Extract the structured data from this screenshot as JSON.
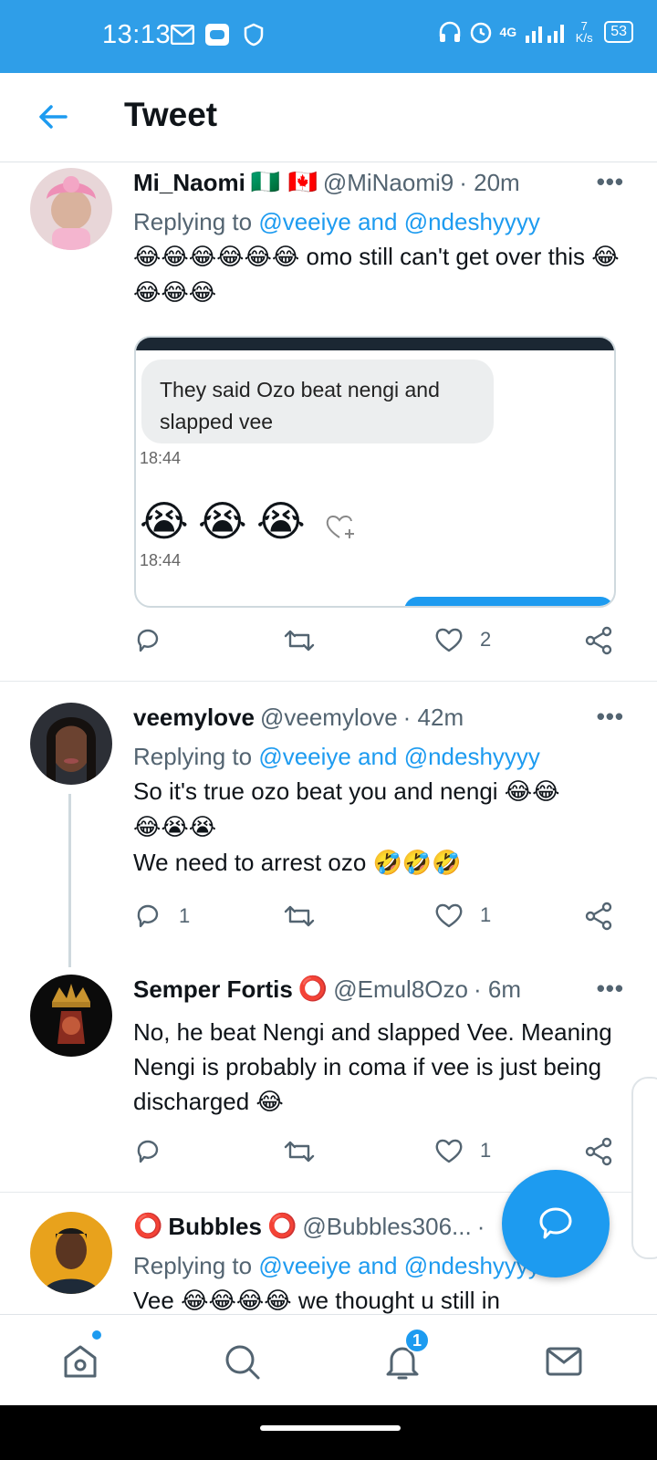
{
  "status_bar": {
    "time": "13:13",
    "network": "4G",
    "speed": "7 K/s",
    "battery": "53"
  },
  "header": {
    "title": "Tweet"
  },
  "tweets": [
    {
      "name": "Mi_Naomi",
      "flags": "🇳🇬 🇨🇦",
      "handle": "@MiNaomi9",
      "time": "· 20m",
      "reply_prefix": "Replying to ",
      "reply_to": "@veeiye and @ndeshyyyy",
      "text_emoji": "😂😂😂😂😂😂",
      "text": " omo still can't get over this ",
      "text_emoji2": "😂😂😂😂",
      "media": {
        "bubble_text": "They said Ozo beat nengi and slapped vee",
        "stamp1": "18:44",
        "emojis": [
          "😭",
          "😭",
          "😭"
        ],
        "stamp2": "18:44"
      },
      "replies": "",
      "retweets": "",
      "likes": "2"
    },
    {
      "name": "veemylove",
      "handle": "@veemylove",
      "time": "· 42m",
      "reply_prefix": "Replying to ",
      "reply_to": "@veeiye and @ndeshyyyy",
      "text_line1": "So it's true ozo beat you and nengi ",
      "text_line1_emoji": "😂😂",
      "text_line2_emoji": "😂😭😭",
      "text_line3": "We need to arrest ozo ",
      "text_line3_emoji": "🤣🤣🤣",
      "replies": "1",
      "retweets": "",
      "likes": "1"
    },
    {
      "name": "Semper Fortis",
      "name_symbol": "⭕",
      "handle": "@Emul8Ozo",
      "time": "· 6m",
      "text": "No, he beat Nengi and slapped Vee. Meaning Nengi is probably in coma if vee is just being discharged ",
      "text_emoji": "😂",
      "replies": "",
      "retweets": "",
      "likes": "1"
    },
    {
      "name": "Bubbles",
      "name_symbol": "⭕",
      "handle": "@Bubbles306...",
      "time": "·",
      "reply_prefix": "Replying to ",
      "reply_to": "@veeiye and @ndeshyyyy",
      "text_start": "Vee ",
      "text_emoji": "😂😂😂😂",
      "text_rest": " we thought u still in"
    }
  ],
  "more_label": "•••",
  "nav": {
    "notifications_badge": "1"
  },
  "colors": {
    "accent": "#1d9bf0",
    "status_bar": "#2f9ee8",
    "secondary_text": "#536471"
  }
}
